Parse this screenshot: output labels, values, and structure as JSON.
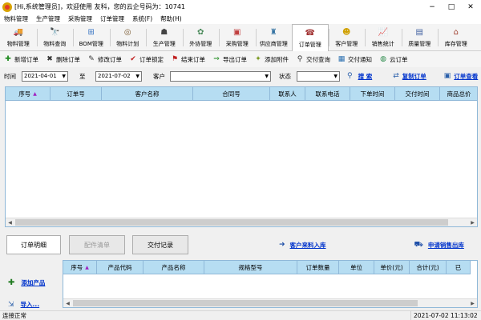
{
  "window": {
    "title": "[Hi,系统管理员]，欢迎使用 友科，您的云企号码为：10741",
    "controls": {
      "minimize": "−",
      "maximize": "□",
      "close": "✕"
    }
  },
  "menu": [
    "物料管理",
    "生产管理",
    "采购管理",
    "订单管理",
    "系统(F)",
    "帮助(H)"
  ],
  "modules": [
    {
      "label": "物料管理",
      "icon": "truck-icon",
      "glyph": "🚚",
      "color": "#2a6fb0"
    },
    {
      "label": "物料查询",
      "icon": "binoculars-icon",
      "glyph": "🔭",
      "color": "#333"
    },
    {
      "label": "BOM管理",
      "icon": "bom-tree-icon",
      "glyph": "⊞",
      "color": "#3a76c4"
    },
    {
      "label": "物料计划",
      "icon": "plan-icon",
      "glyph": "◎",
      "color": "#7a5a30"
    },
    {
      "label": "生产管理",
      "icon": "worker-icon",
      "glyph": "☗",
      "color": "#444"
    },
    {
      "label": "外协管理",
      "icon": "outsource-icon",
      "glyph": "✿",
      "color": "#4a8a5a"
    },
    {
      "label": "采购管理",
      "icon": "purchase-icon",
      "glyph": "▣",
      "color": "#c04040"
    },
    {
      "label": "供应商管理",
      "icon": "supplier-icon",
      "glyph": "♜",
      "color": "#3070a0"
    },
    {
      "label": "订单管理",
      "icon": "order-icon",
      "glyph": "☎",
      "color": "#a03030"
    },
    {
      "label": "客户管理",
      "icon": "smiley-icon",
      "glyph": "☻",
      "color": "#d0a000"
    },
    {
      "label": "销售统计",
      "icon": "chart-icon",
      "glyph": "📈",
      "color": "#3060c0"
    },
    {
      "label": "质量管理",
      "icon": "quality-icon",
      "glyph": "▤",
      "color": "#4060a0"
    },
    {
      "label": "库存管理",
      "icon": "warehouse-icon",
      "glyph": "⌂",
      "color": "#a04030"
    }
  ],
  "selected_module": "订单管理",
  "toolbar": [
    {
      "label": "新增订单",
      "icon": "plus-icon",
      "glyph": "✚",
      "color": "#1f8a1f"
    },
    {
      "label": "删除订单",
      "icon": "delete-x-icon",
      "glyph": "✖",
      "color": "#333"
    },
    {
      "label": "修改订单",
      "icon": "pencil-icon",
      "glyph": "✎",
      "color": "#333"
    },
    {
      "label": "订单锁定",
      "icon": "checkmark-icon",
      "glyph": "✔",
      "color": "#c02020"
    },
    {
      "label": "结束订单",
      "icon": "flag-icon",
      "glyph": "⚑",
      "color": "#c02020"
    },
    {
      "label": "导出订单",
      "icon": "export-icon",
      "glyph": "⇒",
      "color": "#1f8a1f"
    },
    {
      "label": "添加附件",
      "icon": "attachment-icon",
      "glyph": "✦",
      "color": "#7a9a20"
    },
    {
      "label": "交付查询",
      "icon": "binoculars-icon",
      "glyph": "⚲",
      "color": "#333"
    },
    {
      "label": "交付通知",
      "icon": "notify-icon",
      "glyph": "▦",
      "color": "#2a6fb0"
    },
    {
      "label": "云订单",
      "icon": "globe-icon",
      "glyph": "◍",
      "color": "#2a8a4a"
    }
  ],
  "filters": {
    "time_label": "时间",
    "date_from": "2021-04-01",
    "to_label": "至",
    "date_to": "2021-07-02",
    "customer_label": "客户",
    "customer_value": "",
    "status_label": "状态",
    "status_value": "",
    "search_link": "搜 索",
    "copy_link": "复制订单",
    "view_link": "订单查看"
  },
  "orders_table": {
    "columns": [
      "序号",
      "订单号",
      "客户名称",
      "合同号",
      "联系人",
      "联系电话",
      "下单时间",
      "交付时间",
      "商品总价"
    ],
    "rows": []
  },
  "detail": {
    "tabs": [
      "订单明细",
      "配件清单",
      "交付记录"
    ],
    "active_tab": "订单明细",
    "disabled_tab": "配件清单",
    "customer_inbound_link": "客户来料入库",
    "sales_outbound_link": "申请销售出库",
    "add_product_link": "添加产品",
    "import_link": "导入...",
    "columns": [
      "序号",
      "产品代码",
      "产品名称",
      "规格型号",
      "订单数量",
      "单位",
      "单价(元)",
      "合计(元)",
      "已"
    ],
    "rows": []
  },
  "status": {
    "text": "连接正常",
    "datetime": "2021-07-02 11:13:02"
  }
}
